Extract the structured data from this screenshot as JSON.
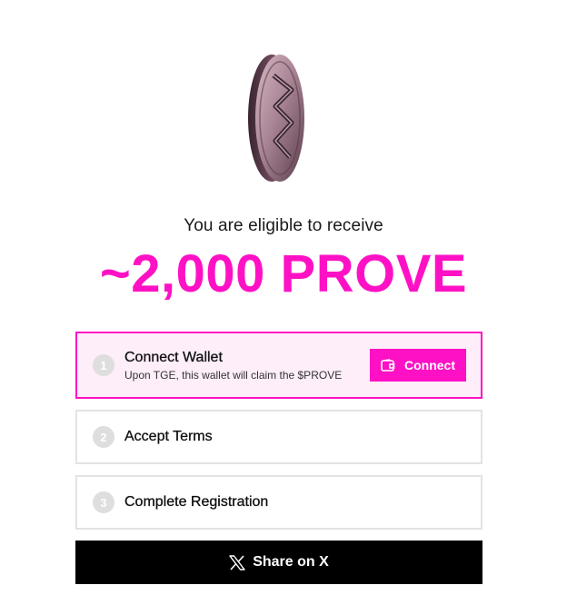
{
  "header": {
    "eligible_text": "You are eligible to receive",
    "amount_text": "~2,000 PROVE"
  },
  "steps": [
    {
      "number": "1",
      "title": "Connect Wallet",
      "subtitle": "Upon TGE, this wallet will claim the $PROVE",
      "action_label": "Connect",
      "action_icon": "wallet-icon"
    },
    {
      "number": "2",
      "title": "Accept Terms"
    },
    {
      "number": "3",
      "title": "Complete Registration"
    }
  ],
  "share": {
    "label": "Share on X",
    "icon": "x-logo-icon"
  },
  "colors": {
    "accent": "#fe11c5",
    "active_step_bg": "#fdeefa",
    "share_bg": "#000000"
  }
}
